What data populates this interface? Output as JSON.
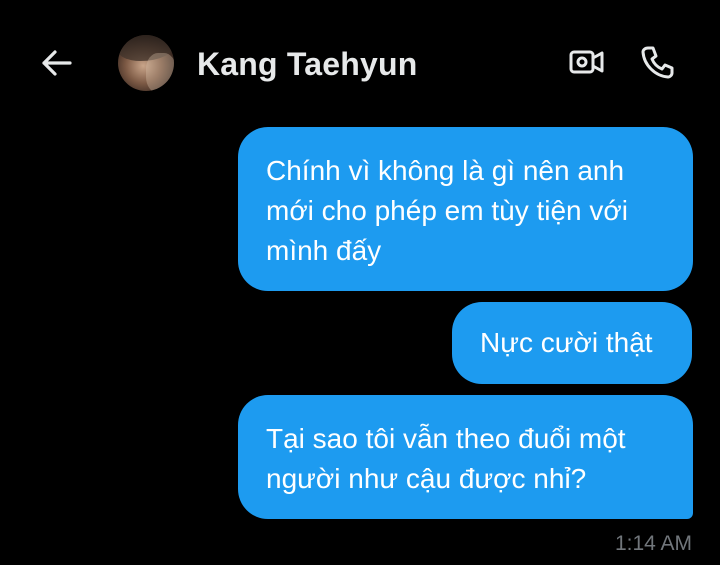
{
  "header": {
    "contact_name": "Kang Taehyun",
    "back_icon": "arrow-left-icon",
    "video_icon": "video-camera-icon",
    "call_icon": "phone-icon"
  },
  "messages": [
    {
      "sender": "me",
      "lines": [
        "Chính vì không là gì nên anh",
        "mới cho phép em tùy tiện với",
        "mình đấy"
      ]
    },
    {
      "sender": "me",
      "lines": [
        "Nực cười thật"
      ]
    },
    {
      "sender": "me",
      "lines": [
        "Tại sao tôi vẫn theo đuổi một",
        "người như cậu được nhỉ?"
      ]
    }
  ],
  "timestamp": "1:14 AM",
  "colors": {
    "background": "#000000",
    "bubble": "#1d9bf0",
    "bubble_text": "#ffffff",
    "header_text": "#e7e9ea",
    "timestamp_text": "#71767b"
  }
}
